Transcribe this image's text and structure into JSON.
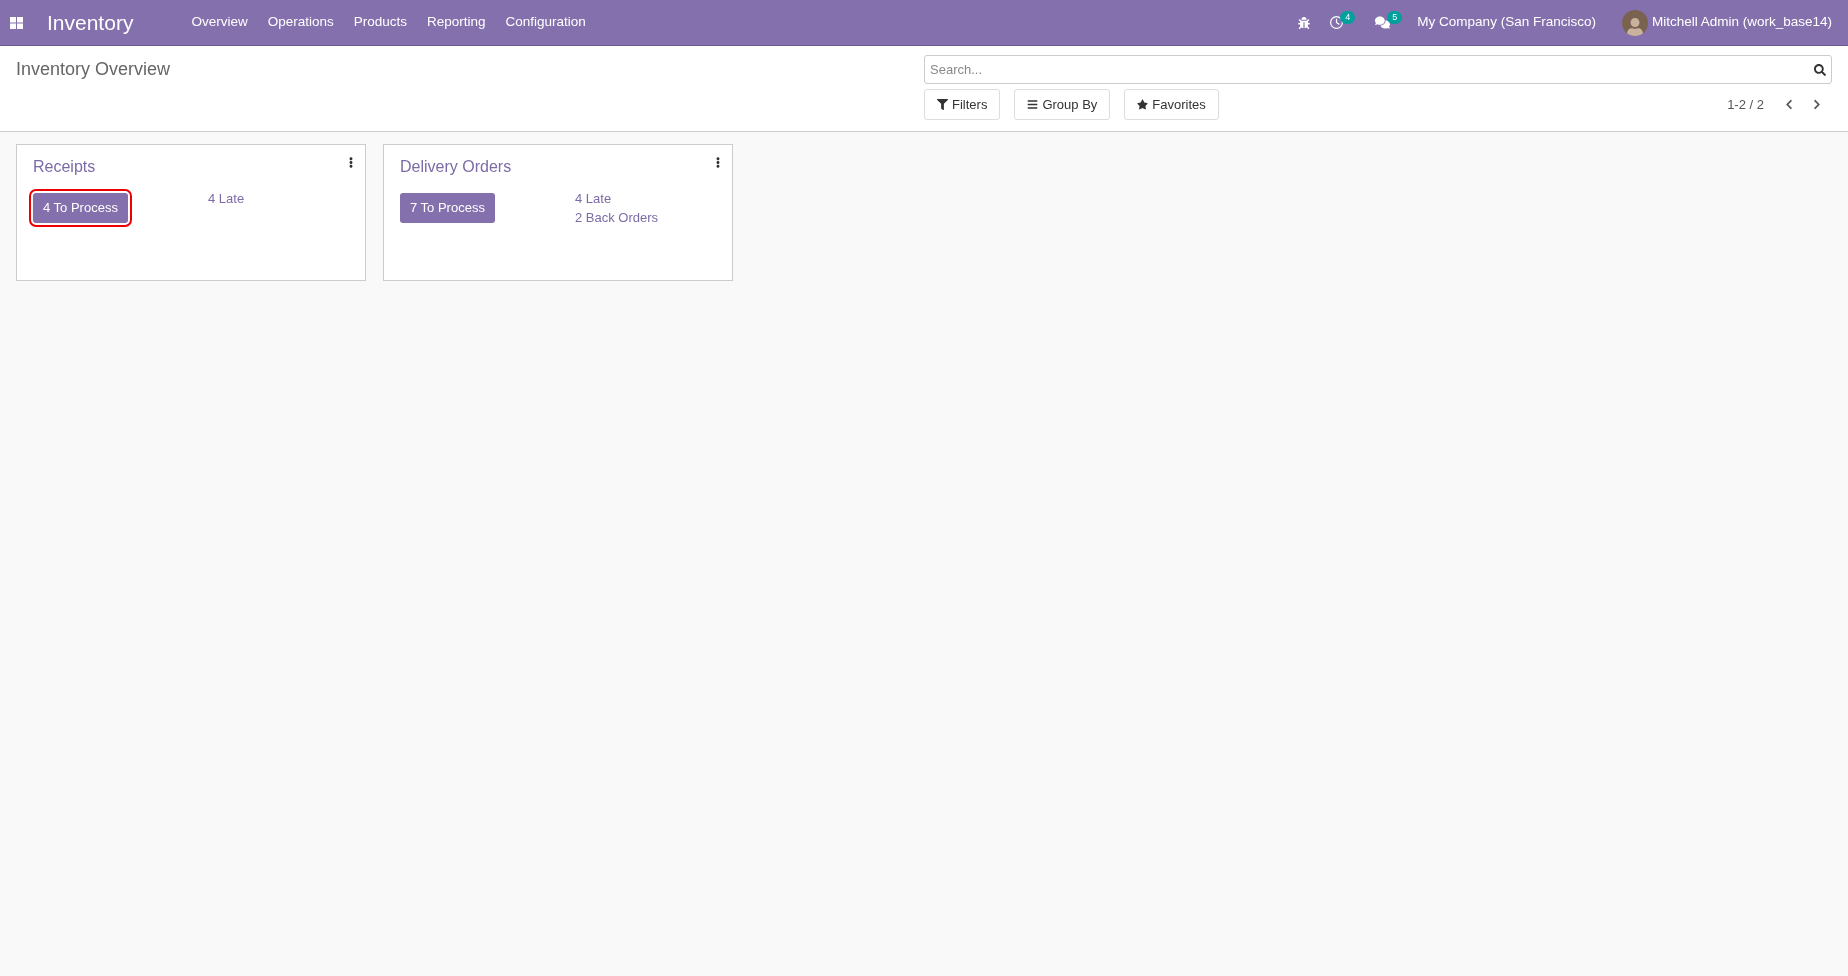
{
  "navbar": {
    "app_title": "Inventory",
    "menu": [
      "Overview",
      "Operations",
      "Products",
      "Reporting",
      "Configuration"
    ],
    "activity_count": "4",
    "message_count": "5",
    "company": "My Company (San Francisco)",
    "user": "Mitchell Admin (work_base14)"
  },
  "control_panel": {
    "title": "Inventory Overview",
    "search": {
      "placeholder": "Search..."
    },
    "buttons": [
      {
        "kind": "filter",
        "label": "Filters"
      },
      {
        "kind": "group",
        "label": "Group By"
      },
      {
        "kind": "favorite",
        "label": "Favorites"
      }
    ],
    "pager": "1-2 / 2"
  },
  "cards": [
    {
      "title": "Receipts",
      "action": "4 To Process",
      "highlighted": true,
      "links": [
        "4 Late"
      ]
    },
    {
      "title": "Delivery Orders",
      "action": "7 To Process",
      "highlighted": false,
      "links": [
        "4 Late",
        "2 Back Orders"
      ]
    }
  ]
}
